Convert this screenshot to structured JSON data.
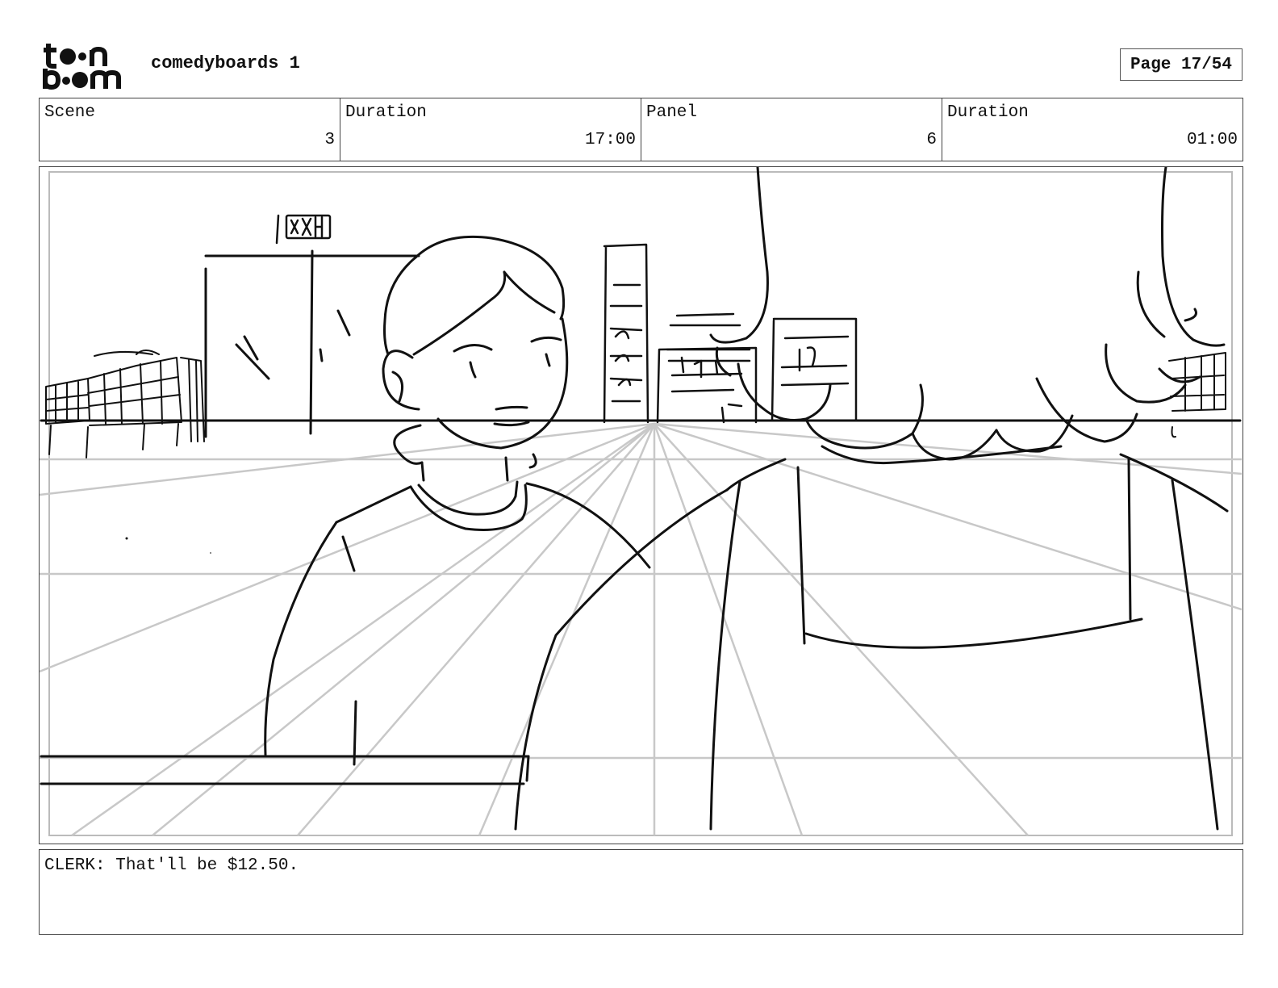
{
  "header": {
    "logo_text": "toonboom",
    "project_title": "comedyboards 1",
    "page_label": "Page 17/54"
  },
  "info": [
    {
      "label": "Scene",
      "value": "3"
    },
    {
      "label": "Duration",
      "value": "17:00"
    },
    {
      "label": "Panel",
      "value": "6"
    },
    {
      "label": "Duration",
      "value": "01:00"
    }
  ],
  "panel": {
    "sign_text": "CXH"
  },
  "caption": "CLERK: That'll be $12.50."
}
